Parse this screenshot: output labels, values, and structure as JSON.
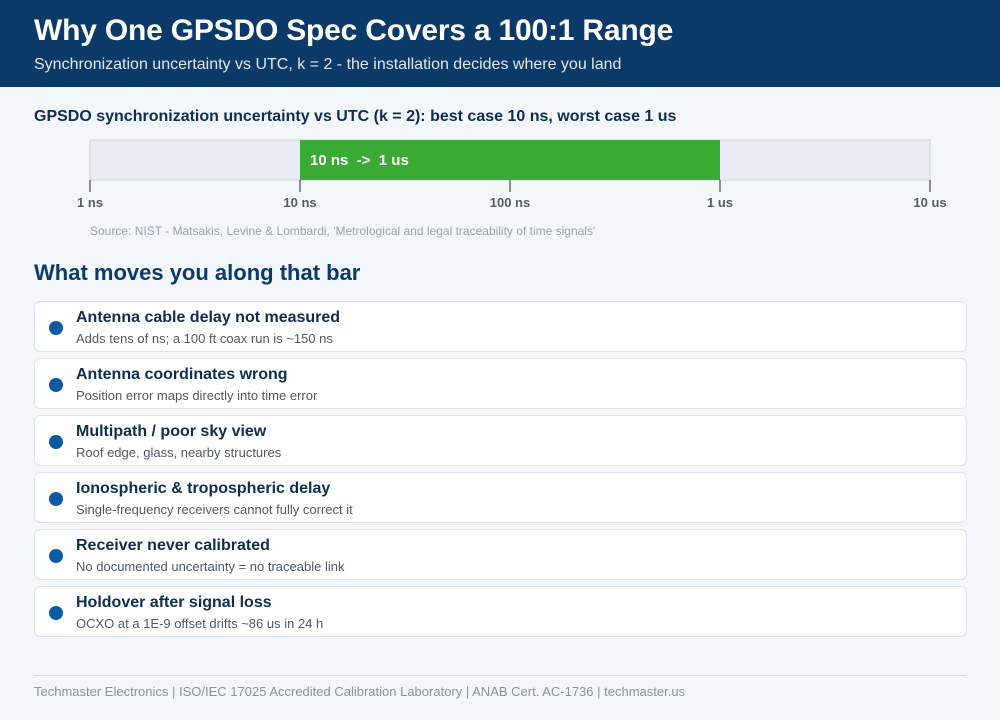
{
  "header": {
    "title": "Why One GPSDO Spec Covers a 100:1 Range",
    "subtitle": "Synchronization uncertainty vs UTC, k = 2 - the installation decides where you land"
  },
  "chart_data": {
    "type": "bar",
    "title": "GPSDO synchronization uncertainty vs UTC (k = 2): best case 10 ns, worst case 1 us",
    "scale": "log",
    "ticks": [
      {
        "label": "1 ns",
        "value_ns": 1
      },
      {
        "label": "10 ns",
        "value_ns": 10
      },
      {
        "label": "100 ns",
        "value_ns": 100
      },
      {
        "label": "1 us",
        "value_ns": 1000
      },
      {
        "label": "10 us",
        "value_ns": 10000
      }
    ],
    "range_ns": [
      1,
      10000
    ],
    "band": {
      "min_ns": 10,
      "max_ns": 1000,
      "label": "10 ns  ->  1 us"
    },
    "colors": {
      "band": "#3aaa35",
      "track": "#e9edf3",
      "track_border": "#d7dde6",
      "tick": "#8a8f96"
    },
    "source": "Source: NIST - Matsakis, Levine & Lombardi, 'Metrological and legal traceability of time signals'"
  },
  "factors": {
    "heading": "What moves you along that bar",
    "items": [
      {
        "title": "Antenna cable delay not measured",
        "desc": "Adds tens of ns; a 100 ft coax run is ~150 ns"
      },
      {
        "title": "Antenna coordinates wrong",
        "desc": "Position error maps directly into time error"
      },
      {
        "title": "Multipath / poor sky view",
        "desc": "Roof edge, glass, nearby structures"
      },
      {
        "title": "Ionospheric & tropospheric delay",
        "desc": "Single-frequency receivers cannot fully correct it"
      },
      {
        "title": "Receiver never calibrated",
        "desc": "No documented uncertainty = no traceable link"
      },
      {
        "title": "Holdover after signal loss",
        "desc": "OCXO at a 1E-9 offset drifts ~86 us in 24 h"
      }
    ]
  },
  "footer": {
    "text": "Techmaster Electronics  |  ISO/IEC 17025 Accredited Calibration Laboratory  |  ANAB Cert. AC-1736  |  techmaster.us"
  },
  "colors": {
    "header_bg": "#0b3a68",
    "bullet": "#0b5aa3"
  }
}
